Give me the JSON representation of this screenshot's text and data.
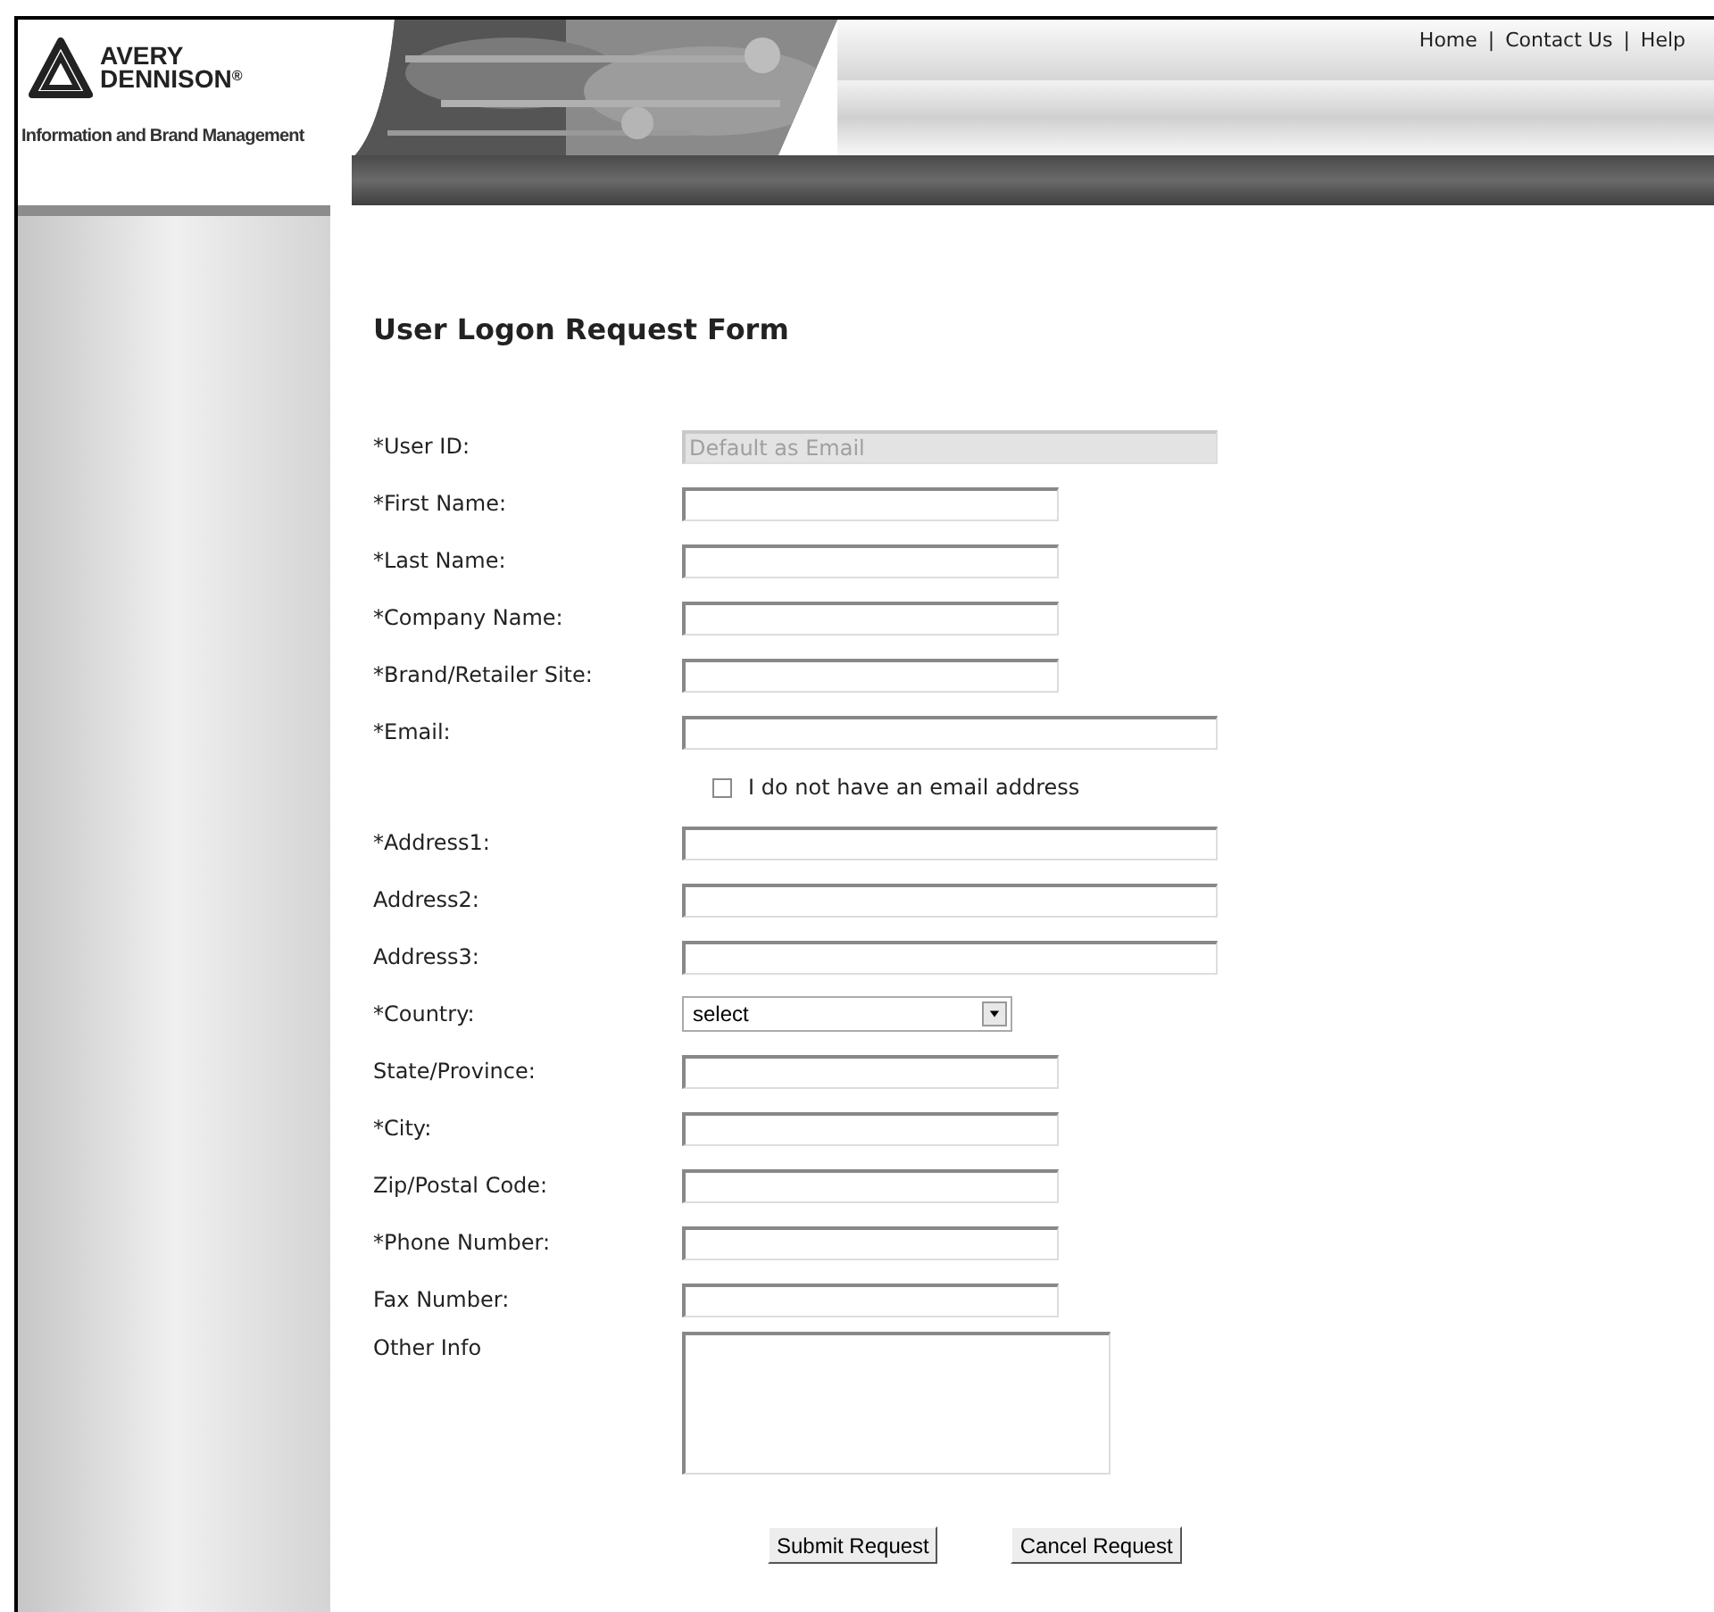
{
  "logo": {
    "line_1": "AVERY",
    "line_2": "DENNISON",
    "mark": "®",
    "tagline": "Information and Brand Management"
  },
  "top_links": [
    "Home",
    "Contact Us",
    "Help"
  ],
  "link_separator": "|",
  "form": {
    "title": "User Logon Request Form",
    "fields": [
      {
        "kind": "long",
        "label": "*User ID:",
        "placeholder": "Default as Email",
        "disabled": true
      },
      {
        "kind": "short",
        "label": "*First Name:",
        "disabled": false
      },
      {
        "kind": "short",
        "label": "*Last Name:",
        "disabled": false
      },
      {
        "kind": "short",
        "label": "*Company Name:",
        "disabled": false
      },
      {
        "kind": "short",
        "label": "*Brand/Retailer Site:",
        "disabled": false
      },
      {
        "kind": "long",
        "label": "*Email:",
        "disabled": false
      },
      {
        "kind": "checkbox",
        "label": "I do not have an email address",
        "checked": false
      },
      {
        "kind": "long",
        "label": "*Address1:",
        "disabled": false
      },
      {
        "kind": "long",
        "label": "Address2:",
        "disabled": false
      },
      {
        "kind": "long",
        "label": "Address3:",
        "disabled": false
      },
      {
        "kind": "select",
        "label": "*Country:",
        "value": "select"
      },
      {
        "kind": "short",
        "label": "State/Province:",
        "disabled": false
      },
      {
        "kind": "short",
        "label": "*City:",
        "disabled": false
      },
      {
        "kind": "short",
        "label": "Zip/Postal Code:",
        "disabled": false
      },
      {
        "kind": "short",
        "label": "*Phone Number:",
        "disabled": false
      },
      {
        "kind": "short",
        "label": "Fax Number:",
        "disabled": false
      },
      {
        "kind": "textarea",
        "label": "Other Info"
      }
    ],
    "buttons": [
      "Submit Request",
      "Cancel Request"
    ]
  }
}
